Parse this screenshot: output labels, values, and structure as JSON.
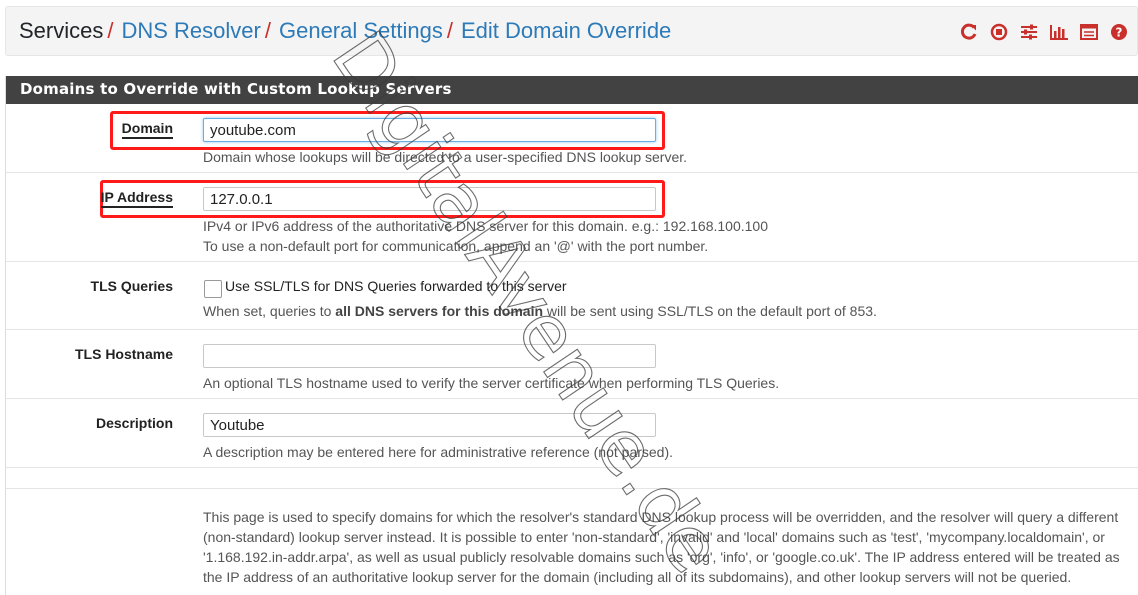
{
  "breadcrumb": {
    "root": "Services",
    "items": [
      "DNS Resolver",
      "General Settings",
      "Edit Domain Override"
    ]
  },
  "toolbar_icons": [
    "reload-icon",
    "stop-icon",
    "settings-sliders-icon",
    "chart-icon",
    "list-icon",
    "help-icon"
  ],
  "panel": {
    "heading": "Domains to Override with Custom Lookup Servers"
  },
  "form": {
    "domain": {
      "label": "Domain",
      "value": "youtube.com",
      "help": "Domain whose lookups will be directed to a user-specified DNS lookup server."
    },
    "ip_address": {
      "label": "IP Address",
      "value": "127.0.0.1",
      "help_line1": "IPv4 or IPv6 address of the authoritative DNS server for this domain. e.g.: 192.168.100.100",
      "help_line2": "To use a non-default port for communication, append an '@' with the port number."
    },
    "tls_queries": {
      "label": "TLS Queries",
      "checkbox_label": "Use SSL/TLS for DNS Queries forwarded to this server",
      "checked": false,
      "help_prefix": "When set, queries to ",
      "help_bold": "all DNS servers for this domain",
      "help_suffix": " will be sent using SSL/TLS on the default port of 853."
    },
    "tls_hostname": {
      "label": "TLS Hostname",
      "value": "",
      "help": "An optional TLS hostname used to verify the server certificate when performing TLS Queries."
    },
    "description": {
      "label": "Description",
      "value": "Youtube",
      "help": "A description may be entered here for administrative reference (not parsed)."
    }
  },
  "info_text": "This page is used to specify domains for which the resolver's standard DNS lookup process will be overridden, and the resolver will query a different (non-standard) lookup server instead. It is possible to enter 'non-standard', 'invalid' and 'local' domains such as 'test', 'mycompany.localdomain', or '1.168.192.in-addr.arpa', as well as usual publicly resolvable domains such as 'org', 'info', or 'google.co.uk'. The IP address entered will be treated as the IP address of an authoritative lookup server for the domain (including all of its subdomains), and other lookup servers will not be queried.",
  "colors": {
    "accent_red": "#c9302c",
    "link_blue": "#2d7ab8",
    "heading_bg": "#424242",
    "highlight_red": "#ff1a1a"
  },
  "watermark": {
    "text": "DigitalAvenue.de"
  }
}
